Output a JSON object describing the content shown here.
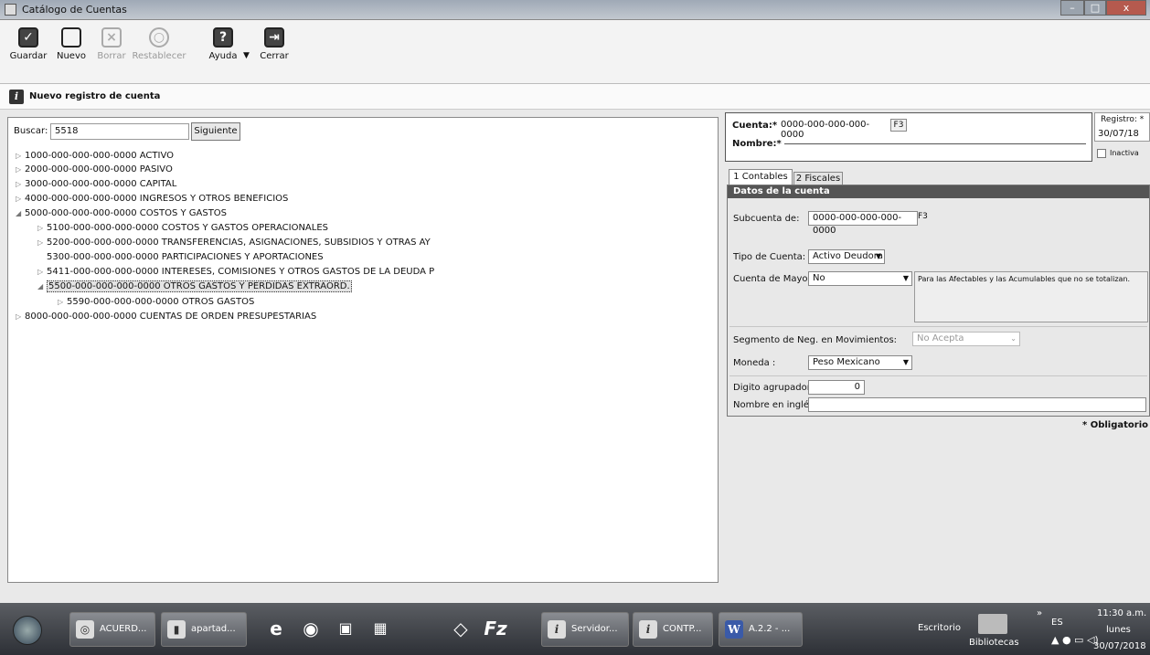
{
  "window": {
    "title": "Catálogo de Cuentas",
    "controls": [
      "–",
      "□",
      "x"
    ]
  },
  "toolbar": {
    "guardar": "Guardar",
    "nuevo": "Nuevo",
    "borrar": "Borrar",
    "restablecer": "Restablecer",
    "ayuda": "Ayuda",
    "cerrar": "Cerrar"
  },
  "banner": {
    "text": "Nuevo registro de cuenta"
  },
  "search": {
    "label": "Buscar:",
    "value": "5518",
    "button": "Siguiente"
  },
  "tree": [
    {
      "label": "1000-000-000-000-0000 ACTIVO",
      "toggle": "▷"
    },
    {
      "label": "2000-000-000-000-0000 PASIVO",
      "toggle": "▷"
    },
    {
      "label": "3000-000-000-000-0000 CAPITAL",
      "toggle": "▷"
    },
    {
      "label": "4000-000-000-000-0000 INGRESOS Y OTROS BENEFICIOS",
      "toggle": "▷"
    },
    {
      "label": "5000-000-000-000-0000 COSTOS Y GASTOS",
      "toggle": "◢"
    },
    {
      "label": "5100-000-000-000-0000 COSTOS Y GASTOS OPERACIONALES",
      "toggle": "▷"
    },
    {
      "label": "5200-000-000-000-0000 TRANSFERENCIAS, ASIGNACIONES, SUBSIDIOS Y OTRAS AY",
      "toggle": "▷"
    },
    {
      "label": "5300-000-000-000-0000 PARTICIPACIONES Y APORTACIONES",
      "toggle": ""
    },
    {
      "label": "5411-000-000-000-0000 INTERESES, COMISIONES Y OTROS GASTOS DE LA DEUDA P",
      "toggle": "▷"
    },
    {
      "label": "5500-000-000-000-0000 OTROS GASTOS Y PERDIDAS EXTRAORD.",
      "toggle": "◢"
    },
    {
      "label": "5590-000-000-000-0000 OTROS GASTOS",
      "toggle": "▷"
    },
    {
      "label": "8000-000-000-000-0000 CUENTAS DE ORDEN PRESUPESTARIAS",
      "toggle": "▷"
    }
  ],
  "cuenta": {
    "label": "Cuenta:*",
    "value": "0000-000-000-000-0000",
    "f3": "F3",
    "nombre_label": "Nombre:*"
  },
  "registro": {
    "label": "Registro: *",
    "date": "30/07/18",
    "inactiva": "Inactiva"
  },
  "tabs": {
    "tab1": "1 Contables",
    "tab2": "2 Fiscales"
  },
  "datos": {
    "header": "Datos de la cuenta",
    "subcuenta_label": "Subcuenta de:",
    "subcuenta_value": "0000-000-000-000-0000",
    "subcuenta_f3": "F3",
    "tipo_label": "Tipo de Cuenta: *",
    "tipo_value": "Activo Deudora",
    "mayor_label": "Cuenta de Mayor:",
    "mayor_value": "No",
    "mayor_note": "Para las Afectables y las Acumulables que no se totalizan.",
    "segmento_label": "Segmento de Neg. en Movimientos:",
    "segmento_value": "No Acepta",
    "moneda_label": "Moneda :",
    "moneda_value": "Peso Mexicano",
    "digito_label": "Digito agrupador:",
    "digito_value": "0",
    "ingles_label": "Nombre en inglés:"
  },
  "obligatorio": "* Obligatorio",
  "taskbar": {
    "buttons": [
      "ACUERD...",
      "apartad...",
      "Servidor...",
      "CONTP...",
      "A.2.2 - ..."
    ],
    "escritorio": "Escritorio",
    "bibliotecas": "Bibliotecas",
    "lang": "ES",
    "time": "11:30 a.m.",
    "day": "lunes",
    "date": "30/07/2018"
  }
}
